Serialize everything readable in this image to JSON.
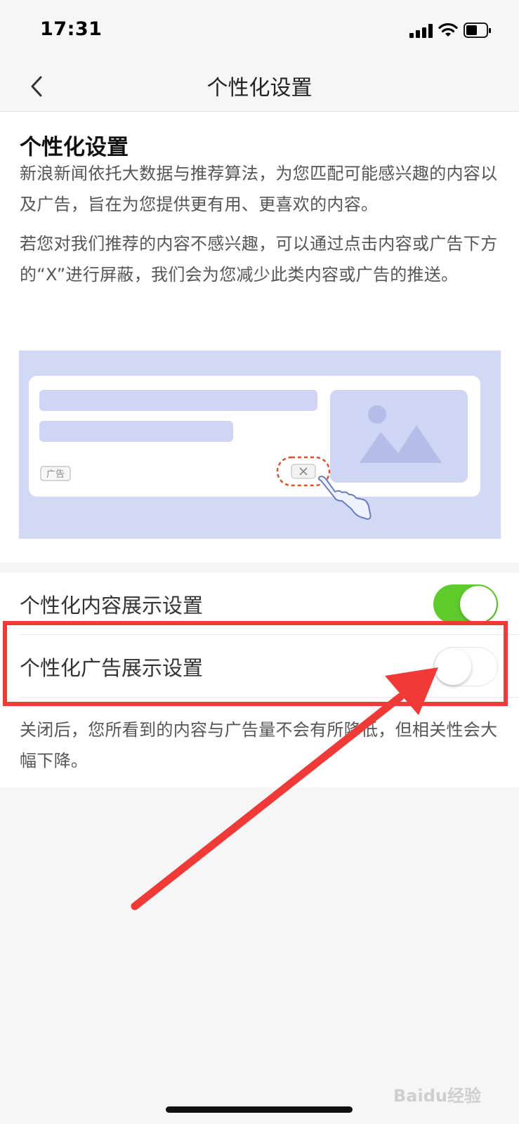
{
  "status_bar": {
    "time": "17:31"
  },
  "nav": {
    "title": "个性化设置",
    "back_icon": "chevron-left-icon"
  },
  "intro": {
    "heading": "个性化设置",
    "paragraph1": "新浪新闻依托大数据与推荐算法，为您匹配可能感兴趣的内容以及广告，旨在为您提供更有用、更喜欢的内容。",
    "paragraph2": "若您对我们推荐的内容不感兴趣，可以通过点击内容或广告下方的“X”进行屏蔽，我们会为您减少此类内容或广告的推送。",
    "illustration": {
      "ad_tag": "广告"
    }
  },
  "settings": {
    "content_toggle": {
      "label": "个性化内容展示设置",
      "on": true
    },
    "ad_toggle": {
      "label": "个性化广告展示设置",
      "on": false
    },
    "note": "关闭后，您所看到的内容与广告量不会有所降低，但相关性会大幅下降。"
  },
  "watermark": "Baidu经验",
  "colors": {
    "toggle_on": "#5ccb2b",
    "highlight": "#f03a38"
  }
}
